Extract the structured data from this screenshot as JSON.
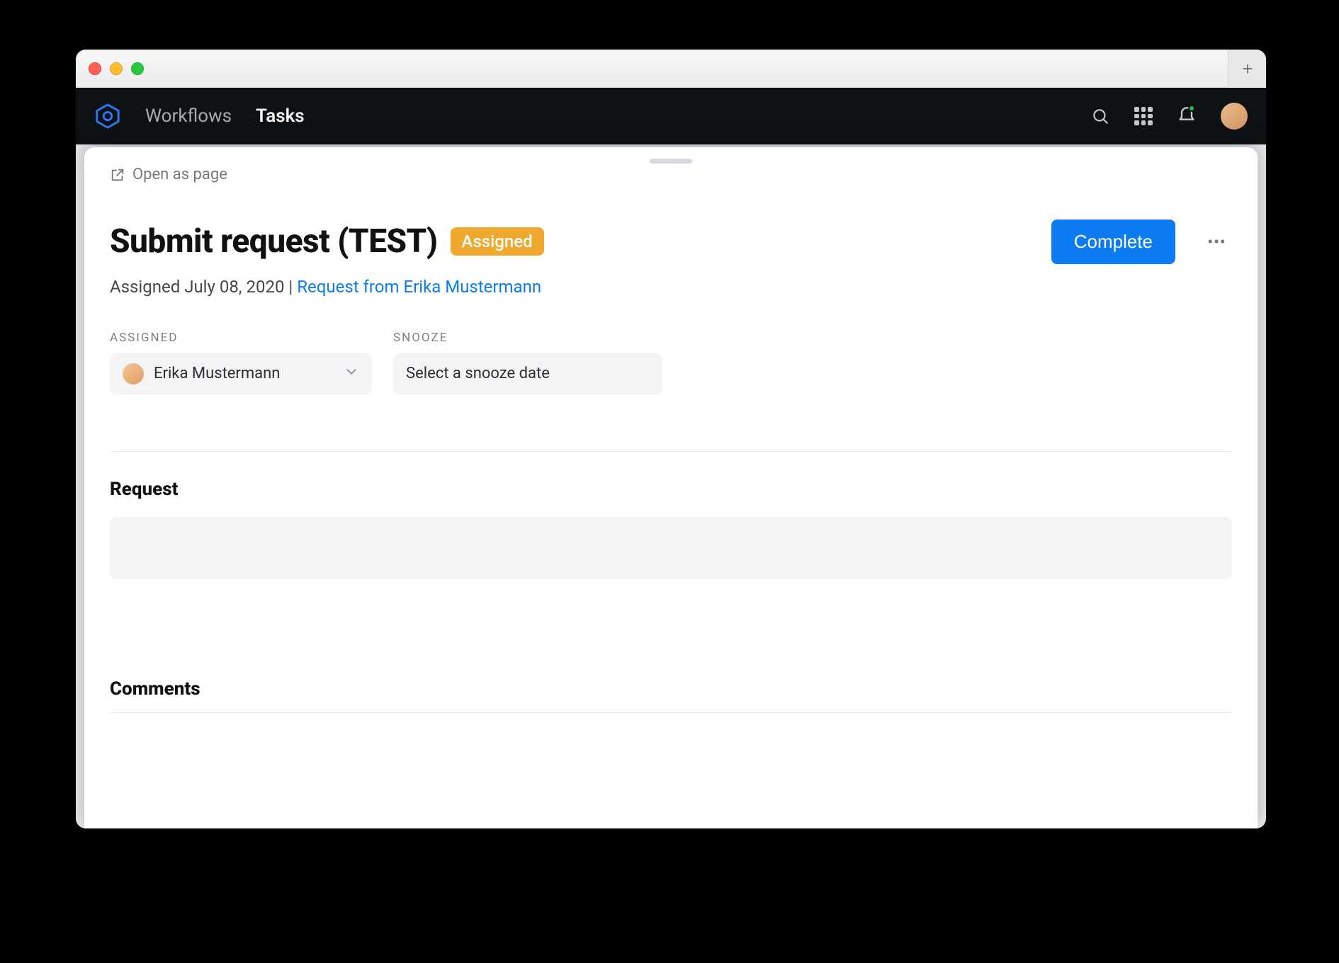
{
  "nav": {
    "workflows": "Workflows",
    "tasks": "Tasks"
  },
  "sheet": {
    "open_as_page": "Open as page",
    "title": "Submit request (TEST)",
    "status_badge": "Assigned",
    "complete_label": "Complete",
    "subline_prefix": "Assigned July 08, 2020 | ",
    "subline_link": "Request from Erika Mustermann"
  },
  "fields": {
    "assigned_label": "ASSIGNED",
    "assignee_name": "Erika Mustermann",
    "snooze_label": "SNOOZE",
    "snooze_placeholder": "Select a snooze date"
  },
  "sections": {
    "request": "Request",
    "comments": "Comments"
  }
}
